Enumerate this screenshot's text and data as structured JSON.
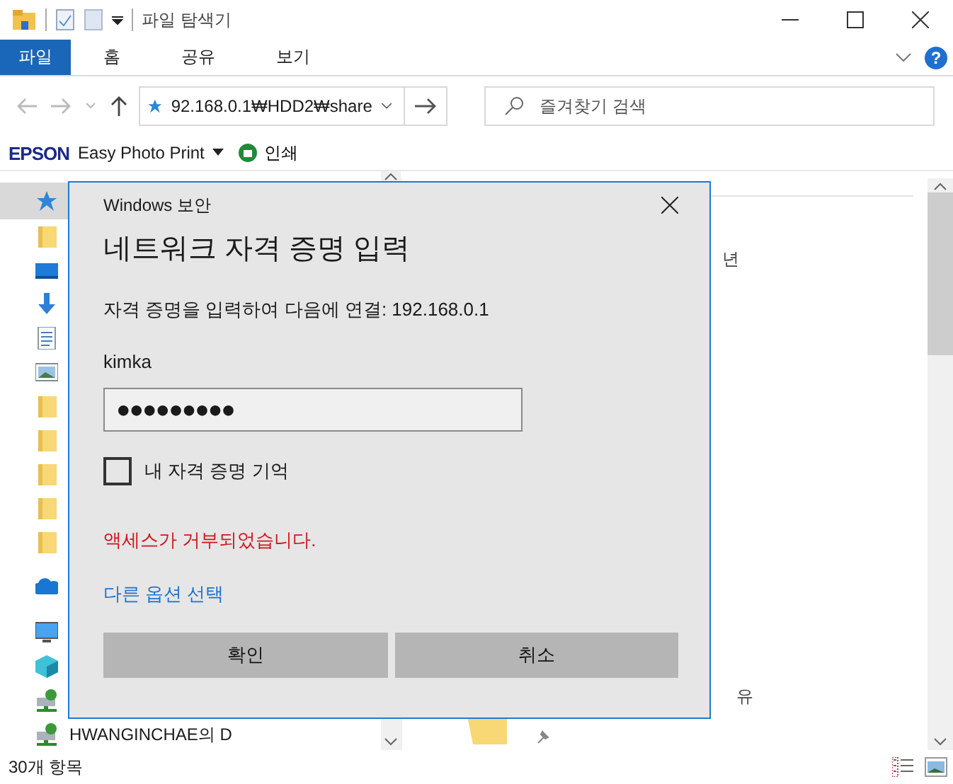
{
  "window": {
    "title": "파일 탐색기"
  },
  "ribbon_tabs": [
    {
      "label": "파일",
      "selected": true
    },
    {
      "label": "홈",
      "selected": false
    },
    {
      "label": "공유",
      "selected": false
    },
    {
      "label": "보기",
      "selected": false
    }
  ],
  "help": "?",
  "address": {
    "path": "92.168.0.1₩HDD2₩share"
  },
  "search": {
    "placeholder": "즐겨찾기 검색"
  },
  "toolbar": {
    "brand": "EPSON",
    "app": "Easy Photo Print",
    "print": "인쇄"
  },
  "nav_items": [
    {
      "kind": "star",
      "selected": true
    },
    {
      "kind": "folder",
      "selected": false
    },
    {
      "kind": "desktop",
      "selected": false
    },
    {
      "kind": "download",
      "selected": false
    },
    {
      "kind": "document",
      "selected": false
    },
    {
      "kind": "pictures",
      "selected": false
    },
    {
      "kind": "folder",
      "selected": false
    },
    {
      "kind": "folder",
      "selected": false
    },
    {
      "kind": "folder",
      "selected": false
    },
    {
      "kind": "folder",
      "selected": false
    },
    {
      "kind": "folder",
      "selected": false
    },
    {
      "kind": "cloud",
      "selected": false
    },
    {
      "kind": "pc",
      "selected": false
    },
    {
      "kind": "cube",
      "selected": false
    },
    {
      "kind": "netdrive",
      "selected": false
    },
    {
      "kind": "netdrive",
      "selected": false,
      "label": "HWANGINCHAE의 D"
    }
  ],
  "content": {
    "texts": [
      "년",
      "유"
    ]
  },
  "status_bar": {
    "count": "30개 항목"
  },
  "dialog": {
    "caption": "Windows 보안",
    "heading": "네트워크 자격 증명 입력",
    "message": "자격 증명을 입력하여 다음에 연결: 192.168.0.1",
    "username": "kimka",
    "password": "●●●●●●●●●",
    "remember": {
      "label": "내 자격 증명 기억",
      "checked": false
    },
    "error": "액세스가 거부되었습니다.",
    "link": "다른 옵션 선택",
    "buttons": [
      "확인",
      "취소"
    ]
  }
}
